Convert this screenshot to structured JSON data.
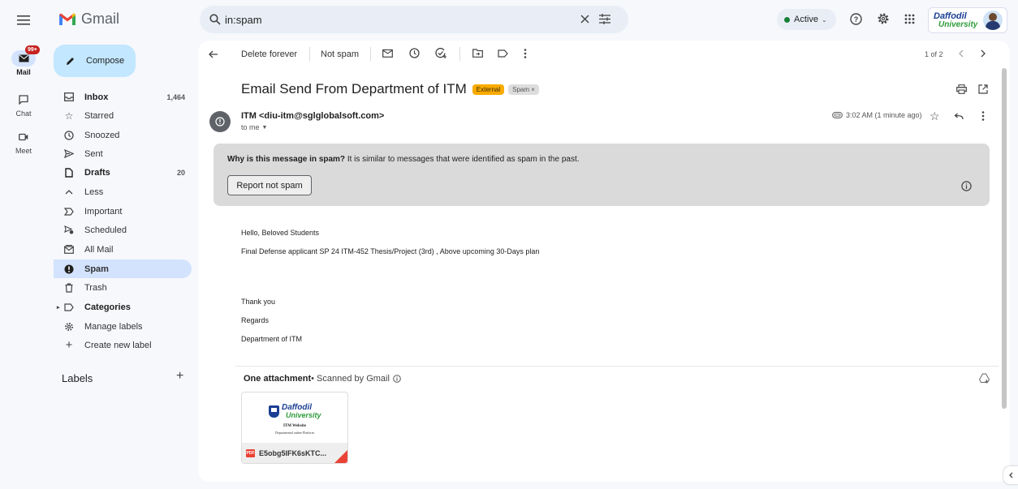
{
  "app": {
    "name": "Gmail"
  },
  "rail": {
    "mail_badge": "99+",
    "mail": "Mail",
    "chat": "Chat",
    "meet": "Meet"
  },
  "search": {
    "value": "in:spam"
  },
  "header": {
    "status": "Active",
    "brand_top": "Daffodil",
    "brand_bottom": "University"
  },
  "sidebar": {
    "compose": "Compose",
    "items": [
      {
        "label": "Inbox",
        "count": "1,464"
      },
      {
        "label": "Starred",
        "count": ""
      },
      {
        "label": "Snoozed",
        "count": ""
      },
      {
        "label": "Sent",
        "count": ""
      },
      {
        "label": "Drafts",
        "count": "20"
      },
      {
        "label": "Less",
        "count": ""
      },
      {
        "label": "Important",
        "count": ""
      },
      {
        "label": "Scheduled",
        "count": ""
      },
      {
        "label": "All Mail",
        "count": ""
      },
      {
        "label": "Spam",
        "count": ""
      },
      {
        "label": "Trash",
        "count": ""
      },
      {
        "label": "Categories",
        "count": ""
      },
      {
        "label": "Manage labels",
        "count": ""
      },
      {
        "label": "Create new label",
        "count": ""
      }
    ],
    "labels_heading": "Labels"
  },
  "toolbar": {
    "delete_forever": "Delete forever",
    "not_spam": "Not spam",
    "pagination": "1 of 2"
  },
  "email": {
    "subject": "Email Send From Department of ITM",
    "tag_external": "External",
    "tag_spam": "Spam ×",
    "sender": "ITM <diu-itm@sglglobalsoft.com>",
    "to": "to me",
    "time": "3:02 AM (1 minute ago)"
  },
  "spam_notice": {
    "question": "Why is this message in spam?",
    "reason": " It is similar to messages that were identified as spam in the past.",
    "button": "Report not spam"
  },
  "body": {
    "greeting": "Hello, Beloved Students",
    "line1": "Final Defense applicant SP 24 ITM-452 Thesis/Project (3rd) , Above upcoming 30-Days plan",
    "thanks": "Thank you",
    "regards": "Regards",
    "signature": "Department of ITM"
  },
  "attachment": {
    "heading": "One attachment",
    "scanned": " • Scanned by Gmail",
    "thumb_brand_top": "Daffodil",
    "thumb_brand_bottom": "University",
    "thumb_title": "ITM Website",
    "thumb_sub": "Departmental online Platform",
    "filename": "E5obg5IFK6sKTC...",
    "type": "PDF"
  },
  "colors": {
    "accent": "#d3e3fd",
    "compose": "#c2e7ff",
    "active_dot": "#188038",
    "external": "#f9ab00",
    "pdf": "#ea4335"
  }
}
